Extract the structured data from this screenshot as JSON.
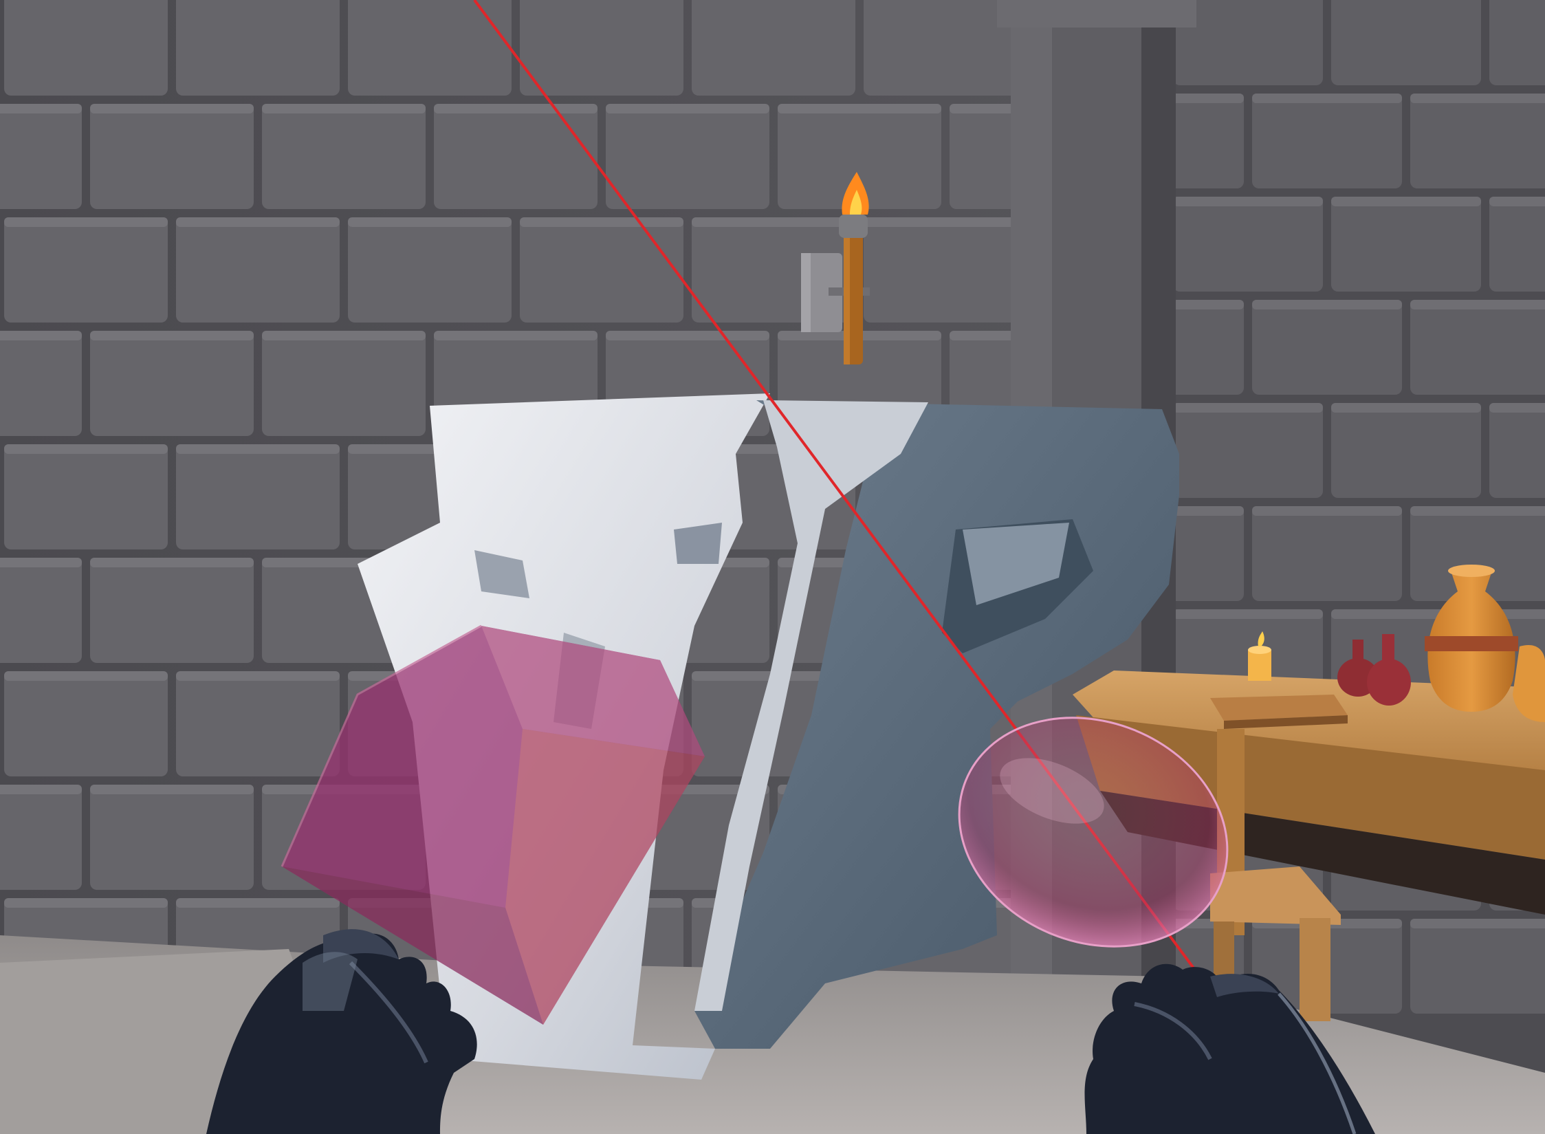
{
  "scene": {
    "kind": "vr-dungeon-room",
    "objects": [
      {
        "name": "voxel-letters",
        "letters": [
          "V",
          "R"
        ]
      },
      {
        "name": "wall-torch"
      },
      {
        "name": "wooden-table"
      },
      {
        "name": "wooden-bench"
      },
      {
        "name": "candle"
      },
      {
        "name": "book"
      },
      {
        "name": "vase"
      },
      {
        "name": "potion-bottle"
      },
      {
        "name": "stone-pillar"
      }
    ],
    "tools": [
      {
        "name": "box-brush",
        "shape": "cube"
      },
      {
        "name": "sphere-brush",
        "shape": "sphere"
      }
    ],
    "hands": [
      "left-hand",
      "right-hand"
    ],
    "pointer": "laser-pointer"
  },
  "colors": {
    "wall_stone": "#5c5b60",
    "mortar": "#3b3a3e",
    "floor": "#aaa6a4",
    "sculpt_light": "#e4e6eb",
    "sculpt_dark": "#526272",
    "wood": "#c99556",
    "torch_flame": "#ff8a1e",
    "laser": "#e0262a",
    "brush_tint": "#b0306a",
    "glove": "#1c2230"
  }
}
